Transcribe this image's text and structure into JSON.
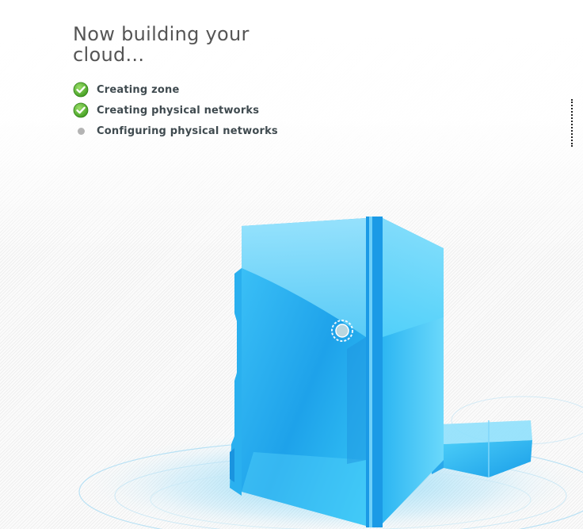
{
  "heading": {
    "title": "Now building your cloud..."
  },
  "steps": [
    {
      "label": "Creating zone",
      "state": "done",
      "icon": "checkmark-icon"
    },
    {
      "label": "Creating physical networks",
      "state": "done",
      "icon": "checkmark-icon"
    },
    {
      "label": "Configuring physical networks",
      "state": "in-progress",
      "icon": "pending-dot-icon"
    }
  ],
  "illustration": {
    "icon": "cloud-server-icon",
    "colors": {
      "accent": "#25b0f0",
      "glow": "#7fd6fb",
      "check": "#4caf2b"
    }
  }
}
